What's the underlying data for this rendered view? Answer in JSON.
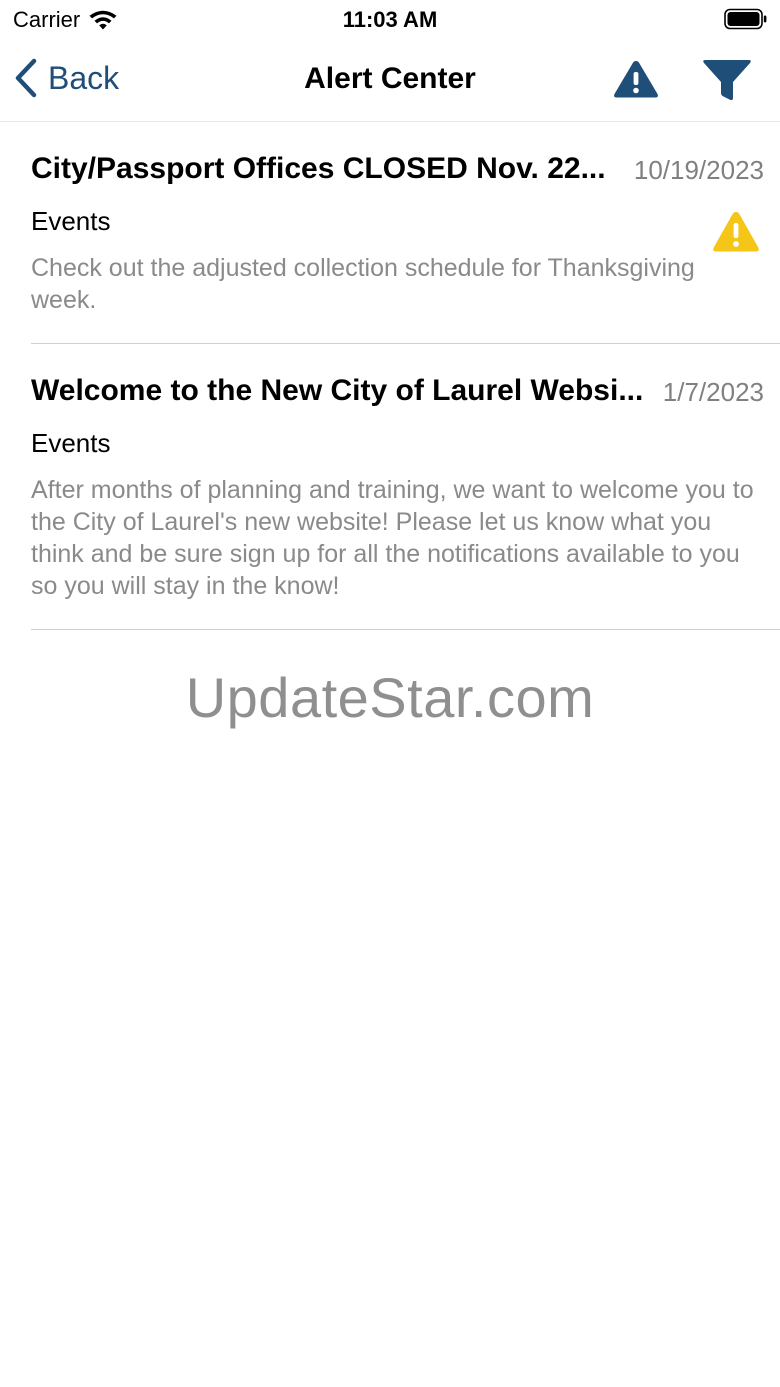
{
  "status_bar": {
    "carrier": "Carrier",
    "time": "11:03 AM"
  },
  "nav": {
    "back_label": "Back",
    "title": "Alert Center",
    "accent_color": "#1f4e79"
  },
  "alerts": [
    {
      "title": "City/Passport Offices CLOSED Nov. 22...",
      "date": "10/19/2023",
      "category": "Events",
      "body": "Check out the adjusted collection schedule for Thanksgiving week.",
      "icon": "warning-icon",
      "icon_color": "#f5c518"
    },
    {
      "title": "Welcome to the New City of Laurel Websi...",
      "date": "1/7/2023",
      "category": "Events",
      "body": "After months of planning and training, we want to welcome you to the City of Laurel's new website! Please let us know what you think and be sure sign up for all the notifications available to you so you will stay in the know!"
    }
  ],
  "watermark": "UpdateStar.com"
}
